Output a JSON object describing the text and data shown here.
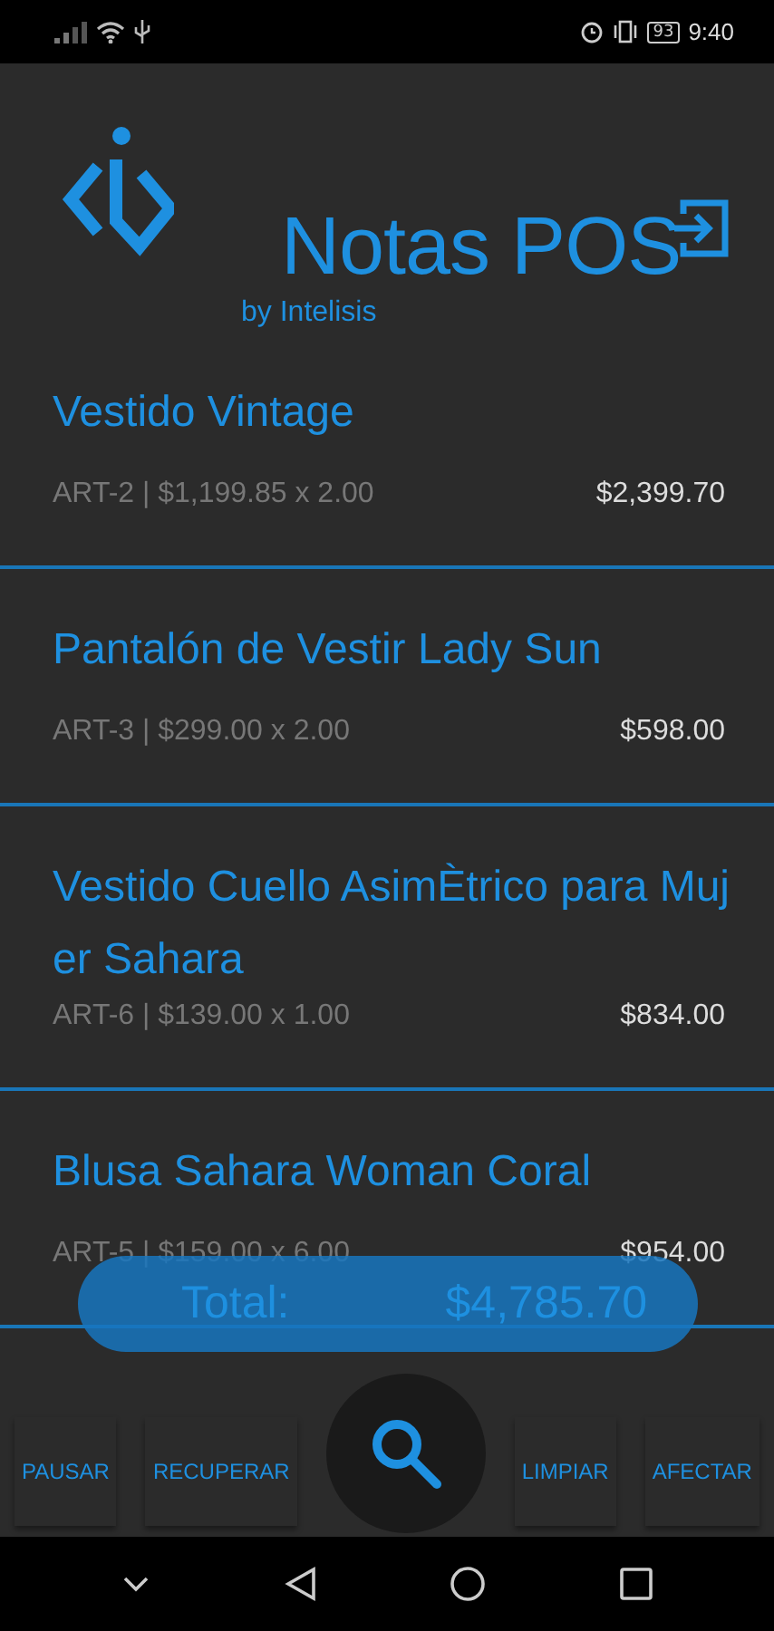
{
  "status_bar": {
    "battery": "93",
    "time": "9:40"
  },
  "header": {
    "title": "Notas POS",
    "subtitle": "by Intelisis"
  },
  "items": [
    {
      "name": "Vestido Vintage",
      "detail": "ART-2 | $1,199.85 x 2.00",
      "amount": "$2,399.70"
    },
    {
      "name": "Pantalón de Vestir Lady Sun",
      "detail": "ART-3 | $299.00 x 2.00",
      "amount": "$598.00"
    },
    {
      "name": "Vestido Cuello AsimÈtrico para Mujer Sahara",
      "detail": "ART-6 | $139.00 x 1.00",
      "amount": "$834.00"
    },
    {
      "name": "Blusa Sahara Woman Coral",
      "detail": "ART-5 | $159.00 x 6.00",
      "amount": "$954.00"
    }
  ],
  "total": {
    "label": "Total:",
    "value": "$4,785.70"
  },
  "actions_left": [
    "PAUSAR",
    "RECUPERAR"
  ],
  "actions_right": [
    "LIMPIAR",
    "AFECTAR"
  ]
}
